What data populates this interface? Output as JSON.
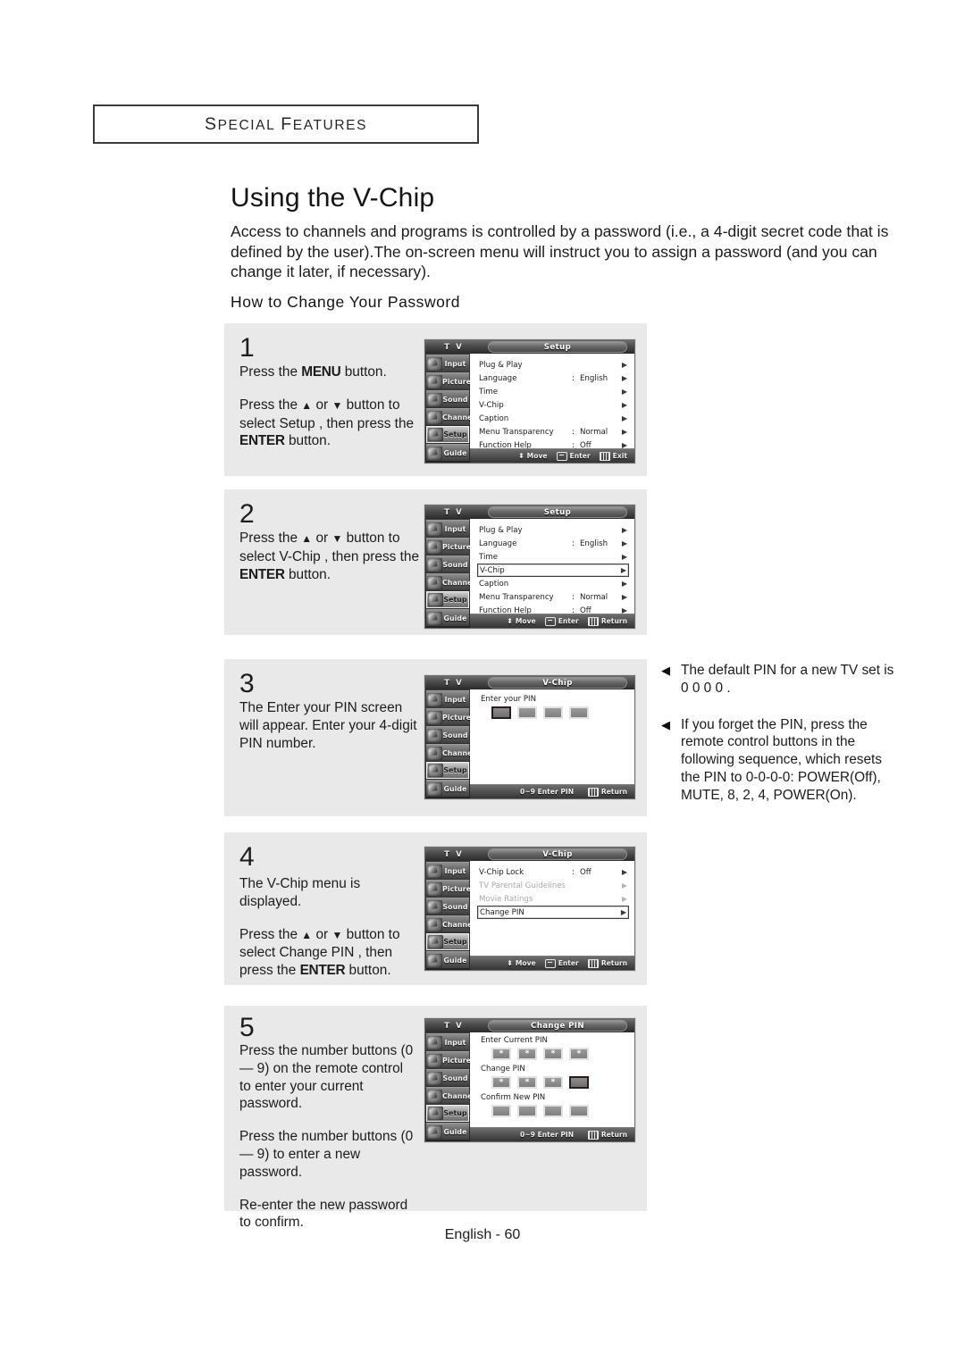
{
  "header": {
    "running_head": "Special Features"
  },
  "title": "Using the V-Chip",
  "intro": "Access to channels and programs is controlled by a password (i.e., a 4-digit secret code that is defined by the user).The on-screen menu will instruct you to assign a password (and you can change it later, if necessary).",
  "subhead": "How to Change Your Password",
  "footer": "English - 60",
  "steps": [
    {
      "number": "1",
      "para1_a": "Press the ",
      "para1_key": "MENU",
      "para1_b": " button.",
      "para2_a": "Press the ",
      "para2_up": "▲",
      "para2_mid": " or ",
      "para2_down": "▼",
      "para2_b": " button to select  Setup , then press the ",
      "para2_key": "ENTER",
      "para2_c": " button."
    },
    {
      "number": "2",
      "para_a": "Press the ",
      "para_up": "▲",
      "para_mid": " or ",
      "para_down": "▼",
      "para_b": " button to select  V-Chip , then press the ",
      "para_key": "ENTER",
      "para_c": " button."
    },
    {
      "number": "3",
      "para": "The  Enter your PIN  screen will appear. Enter your 4-digit PIN number."
    },
    {
      "number": "4",
      "para1": "The  V-Chip  menu is displayed.",
      "para2_a": "Press the ",
      "para2_up": "▲",
      "para2_mid": " or ",
      "para2_down": "▼",
      "para2_b": " button to select  Change PIN , then press the ",
      "para2_key": "ENTER",
      "para2_c": " button."
    },
    {
      "number": "5",
      "para1": "Press the number buttons (0 — 9) on the remote control to enter your current password.",
      "para2": "Press the number buttons (0 — 9) to enter a new password.",
      "para3": "Re-enter the new password to confirm."
    }
  ],
  "notes": [
    {
      "bullet": "◀",
      "text": "The default PIN for a new TV set is  0 0 0 0 ."
    },
    {
      "bullet": "◀",
      "text": "If you forget the PIN, press the remote control buttons in the following sequence, which resets the PIN to 0-0-0-0: POWER(Off), MUTE, 8, 2, 4, POWER(On)."
    }
  ],
  "osd": {
    "tv_label": "T V",
    "sidebar": [
      {
        "label": "Input",
        "icon": "input-icon",
        "selected": false
      },
      {
        "label": "Picture",
        "icon": "picture-icon",
        "selected": false
      },
      {
        "label": "Sound",
        "icon": "sound-icon",
        "selected": false
      },
      {
        "label": "Channel",
        "icon": "channel-icon",
        "selected": false
      },
      {
        "label": "Setup",
        "icon": "setup-icon",
        "selected": true
      },
      {
        "label": "Guide",
        "icon": "guide-icon",
        "selected": false
      }
    ],
    "screen1": {
      "title": "Setup",
      "rows": [
        {
          "name": "Plug & Play",
          "colon": "",
          "value": "",
          "arrow": "▶",
          "highlight": false,
          "dim": false
        },
        {
          "name": "Language",
          "colon": ":",
          "value": "English",
          "arrow": "▶",
          "highlight": false,
          "dim": false
        },
        {
          "name": "Time",
          "colon": "",
          "value": "",
          "arrow": "▶",
          "highlight": false,
          "dim": false
        },
        {
          "name": "V-Chip",
          "colon": "",
          "value": "",
          "arrow": "▶",
          "highlight": false,
          "dim": false
        },
        {
          "name": "Caption",
          "colon": "",
          "value": "",
          "arrow": "▶",
          "highlight": false,
          "dim": false
        },
        {
          "name": "Menu Transparency",
          "colon": ":",
          "value": "Normal",
          "arrow": "▶",
          "highlight": false,
          "dim": false
        },
        {
          "name": "Function Help",
          "colon": ":",
          "value": "Off",
          "arrow": "▶",
          "highlight": false,
          "dim": false
        }
      ],
      "foot": [
        {
          "icon": "move-icon",
          "label": "Move"
        },
        {
          "icon": "enter-icon",
          "label": "Enter"
        },
        {
          "icon": "exit-icon",
          "label": "Exit"
        }
      ]
    },
    "screen2": {
      "title": "Setup",
      "rows": [
        {
          "name": "Plug & Play",
          "colon": "",
          "value": "",
          "arrow": "▶",
          "highlight": false,
          "dim": false
        },
        {
          "name": "Language",
          "colon": ":",
          "value": "English",
          "arrow": "▶",
          "highlight": false,
          "dim": false
        },
        {
          "name": "Time",
          "colon": "",
          "value": "",
          "arrow": "▶",
          "highlight": false,
          "dim": false
        },
        {
          "name": "V-Chip",
          "colon": "",
          "value": "",
          "arrow": "▶",
          "highlight": true,
          "dim": false
        },
        {
          "name": "Caption",
          "colon": "",
          "value": "",
          "arrow": "▶",
          "highlight": false,
          "dim": false
        },
        {
          "name": "Menu Transparency",
          "colon": ":",
          "value": "Normal",
          "arrow": "▶",
          "highlight": false,
          "dim": false
        },
        {
          "name": "Function Help",
          "colon": ":",
          "value": "Off",
          "arrow": "▶",
          "highlight": false,
          "dim": false
        }
      ],
      "foot": [
        {
          "icon": "move-icon",
          "label": "Move"
        },
        {
          "icon": "enter-icon",
          "label": "Enter"
        },
        {
          "icon": "exit-icon",
          "label": "Return"
        }
      ]
    },
    "screen3": {
      "title": "V-Chip",
      "pin_label": "Enter your PIN",
      "pin_boxes": [
        "",
        "",
        "",
        ""
      ],
      "pin_current_index": 0,
      "foot_left": "0~9 Enter PIN",
      "foot": [
        {
          "icon": "exit-icon",
          "label": "Return"
        }
      ]
    },
    "screen4": {
      "title": "V-Chip",
      "rows": [
        {
          "name": "V-Chip Lock",
          "colon": ":",
          "value": "Off",
          "arrow": "▶",
          "highlight": false,
          "dim": false
        },
        {
          "name": "TV Parental Guidelines",
          "colon": "",
          "value": "",
          "arrow": "▶",
          "highlight": false,
          "dim": true
        },
        {
          "name": "Movie Ratings",
          "colon": "",
          "value": "",
          "arrow": "▶",
          "highlight": false,
          "dim": true
        },
        {
          "name": "Change PIN",
          "colon": "",
          "value": "",
          "arrow": "▶",
          "highlight": true,
          "dim": false
        }
      ],
      "foot": [
        {
          "icon": "move-icon",
          "label": "Move"
        },
        {
          "icon": "enter-icon",
          "label": "Enter"
        },
        {
          "icon": "exit-icon",
          "label": "Return"
        }
      ]
    },
    "screen5": {
      "title": "Change PIN",
      "groups": [
        {
          "label": "Enter Current PIN",
          "boxes": [
            "*",
            "*",
            "*",
            "*"
          ],
          "current_index": -1
        },
        {
          "label": "Change PIN",
          "boxes": [
            "*",
            "*",
            "*",
            ""
          ],
          "current_index": 3
        },
        {
          "label": "Confirm New PIN",
          "boxes": [
            "",
            "",
            "",
            ""
          ],
          "current_index": -1
        }
      ],
      "foot_left": "0~9 Enter PIN",
      "foot": [
        {
          "icon": "exit-icon",
          "label": "Return"
        }
      ]
    }
  }
}
